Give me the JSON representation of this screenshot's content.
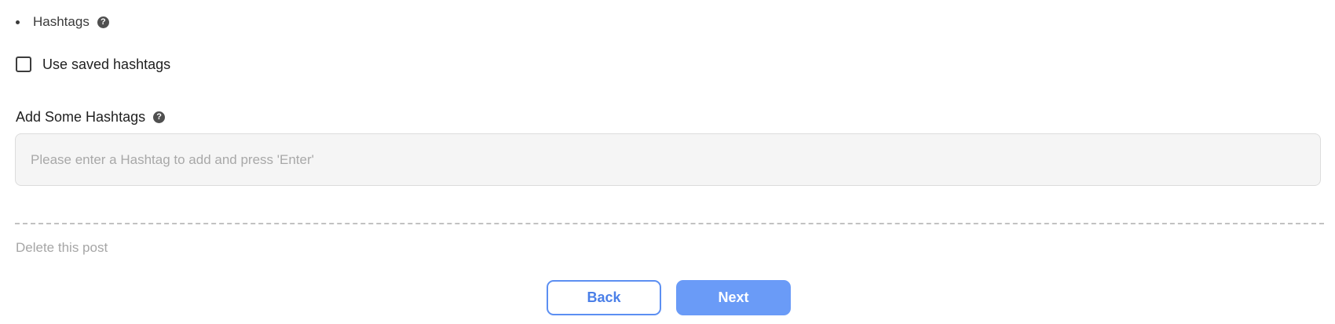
{
  "hashtags_section": {
    "title": "Hashtags",
    "help_icon": "question-circle-icon"
  },
  "use_saved": {
    "label": "Use saved hashtags",
    "checked": false
  },
  "add_hashtags": {
    "label": "Add Some Hashtags",
    "help_icon": "question-circle-icon",
    "placeholder": "Please enter a Hashtag to add and press 'Enter'",
    "value": ""
  },
  "delete_link": "Delete this post",
  "buttons": {
    "back": "Back",
    "next": "Next"
  },
  "colors": {
    "accent": "#6a9bf7",
    "accent_border": "#5c8ff2",
    "muted_text": "#a6a6a6",
    "input_bg": "#f5f5f5"
  }
}
